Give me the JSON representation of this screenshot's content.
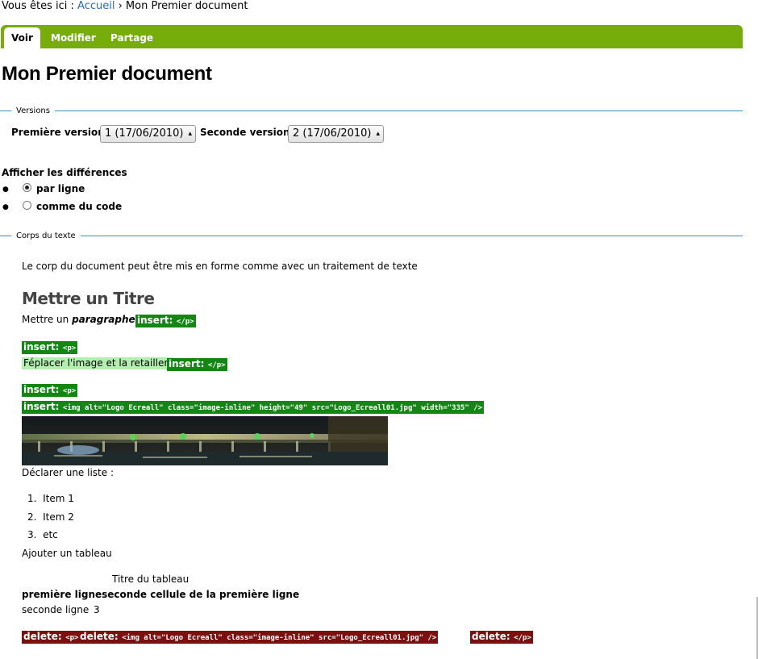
{
  "breadcrumb": {
    "prefix": "Vous êtes ici :",
    "home": "Accueil",
    "separator": "›",
    "current": "Mon Premier document"
  },
  "tabs": [
    {
      "label": "Voir",
      "active": true
    },
    {
      "label": "Modifier",
      "active": false
    },
    {
      "label": "Partage",
      "active": false
    }
  ],
  "page_title": "Mon Premier document",
  "versions": {
    "legend": "Versions",
    "first_label": "Première version",
    "first_value": "1 (17/06/2010)",
    "second_label": "Seconde version",
    "second_value": "2 (17/06/2010)"
  },
  "diff": {
    "label": "Afficher les différences",
    "options": [
      {
        "label": "par ligne",
        "checked": true
      },
      {
        "label": "comme du code",
        "checked": false
      }
    ]
  },
  "body": {
    "legend": "Corps du texte",
    "intro": "Le corp du document peut être mis en forme comme avec un traitement de texte",
    "heading": "Mettre un Titre",
    "para_prefix": "Mettre un",
    "para_emph": "paragraphe",
    "para_suffix": ".",
    "ins_label": "insert:",
    "del_label": "delete:",
    "tag_p_close": "</p>",
    "tag_p_open": "<p>",
    "replace_text": "Féplacer l'image et la retailler.",
    "img_tag": "<img alt=\"Logo Ecreall\" class=\"image-inline\" height=\"49\" src=\"Logo_Ecreall01.jpg\" width=\"335\" />",
    "list_intro": "Déclarer une liste :",
    "list_items": [
      "Item 1",
      "Item 2",
      "etc"
    ],
    "table_intro": "Ajouter un tableau",
    "table_caption": "Titre du tableau",
    "table_row1": "première ligneseconde cellule de la première ligne",
    "table_row2_a": "seconde ligne",
    "table_row2_b": "3",
    "del_img_tag": "<img alt=\"Logo Ecreall\" class=\"image-inline\" src=\"Logo_Ecreall01.jpg\" />"
  },
  "colors": {
    "tab_bar": "#76ad0a",
    "insert": "#138613",
    "delete": "#7c1010",
    "highlight": "#b3f0b0",
    "rule": "#3d8fbd"
  }
}
